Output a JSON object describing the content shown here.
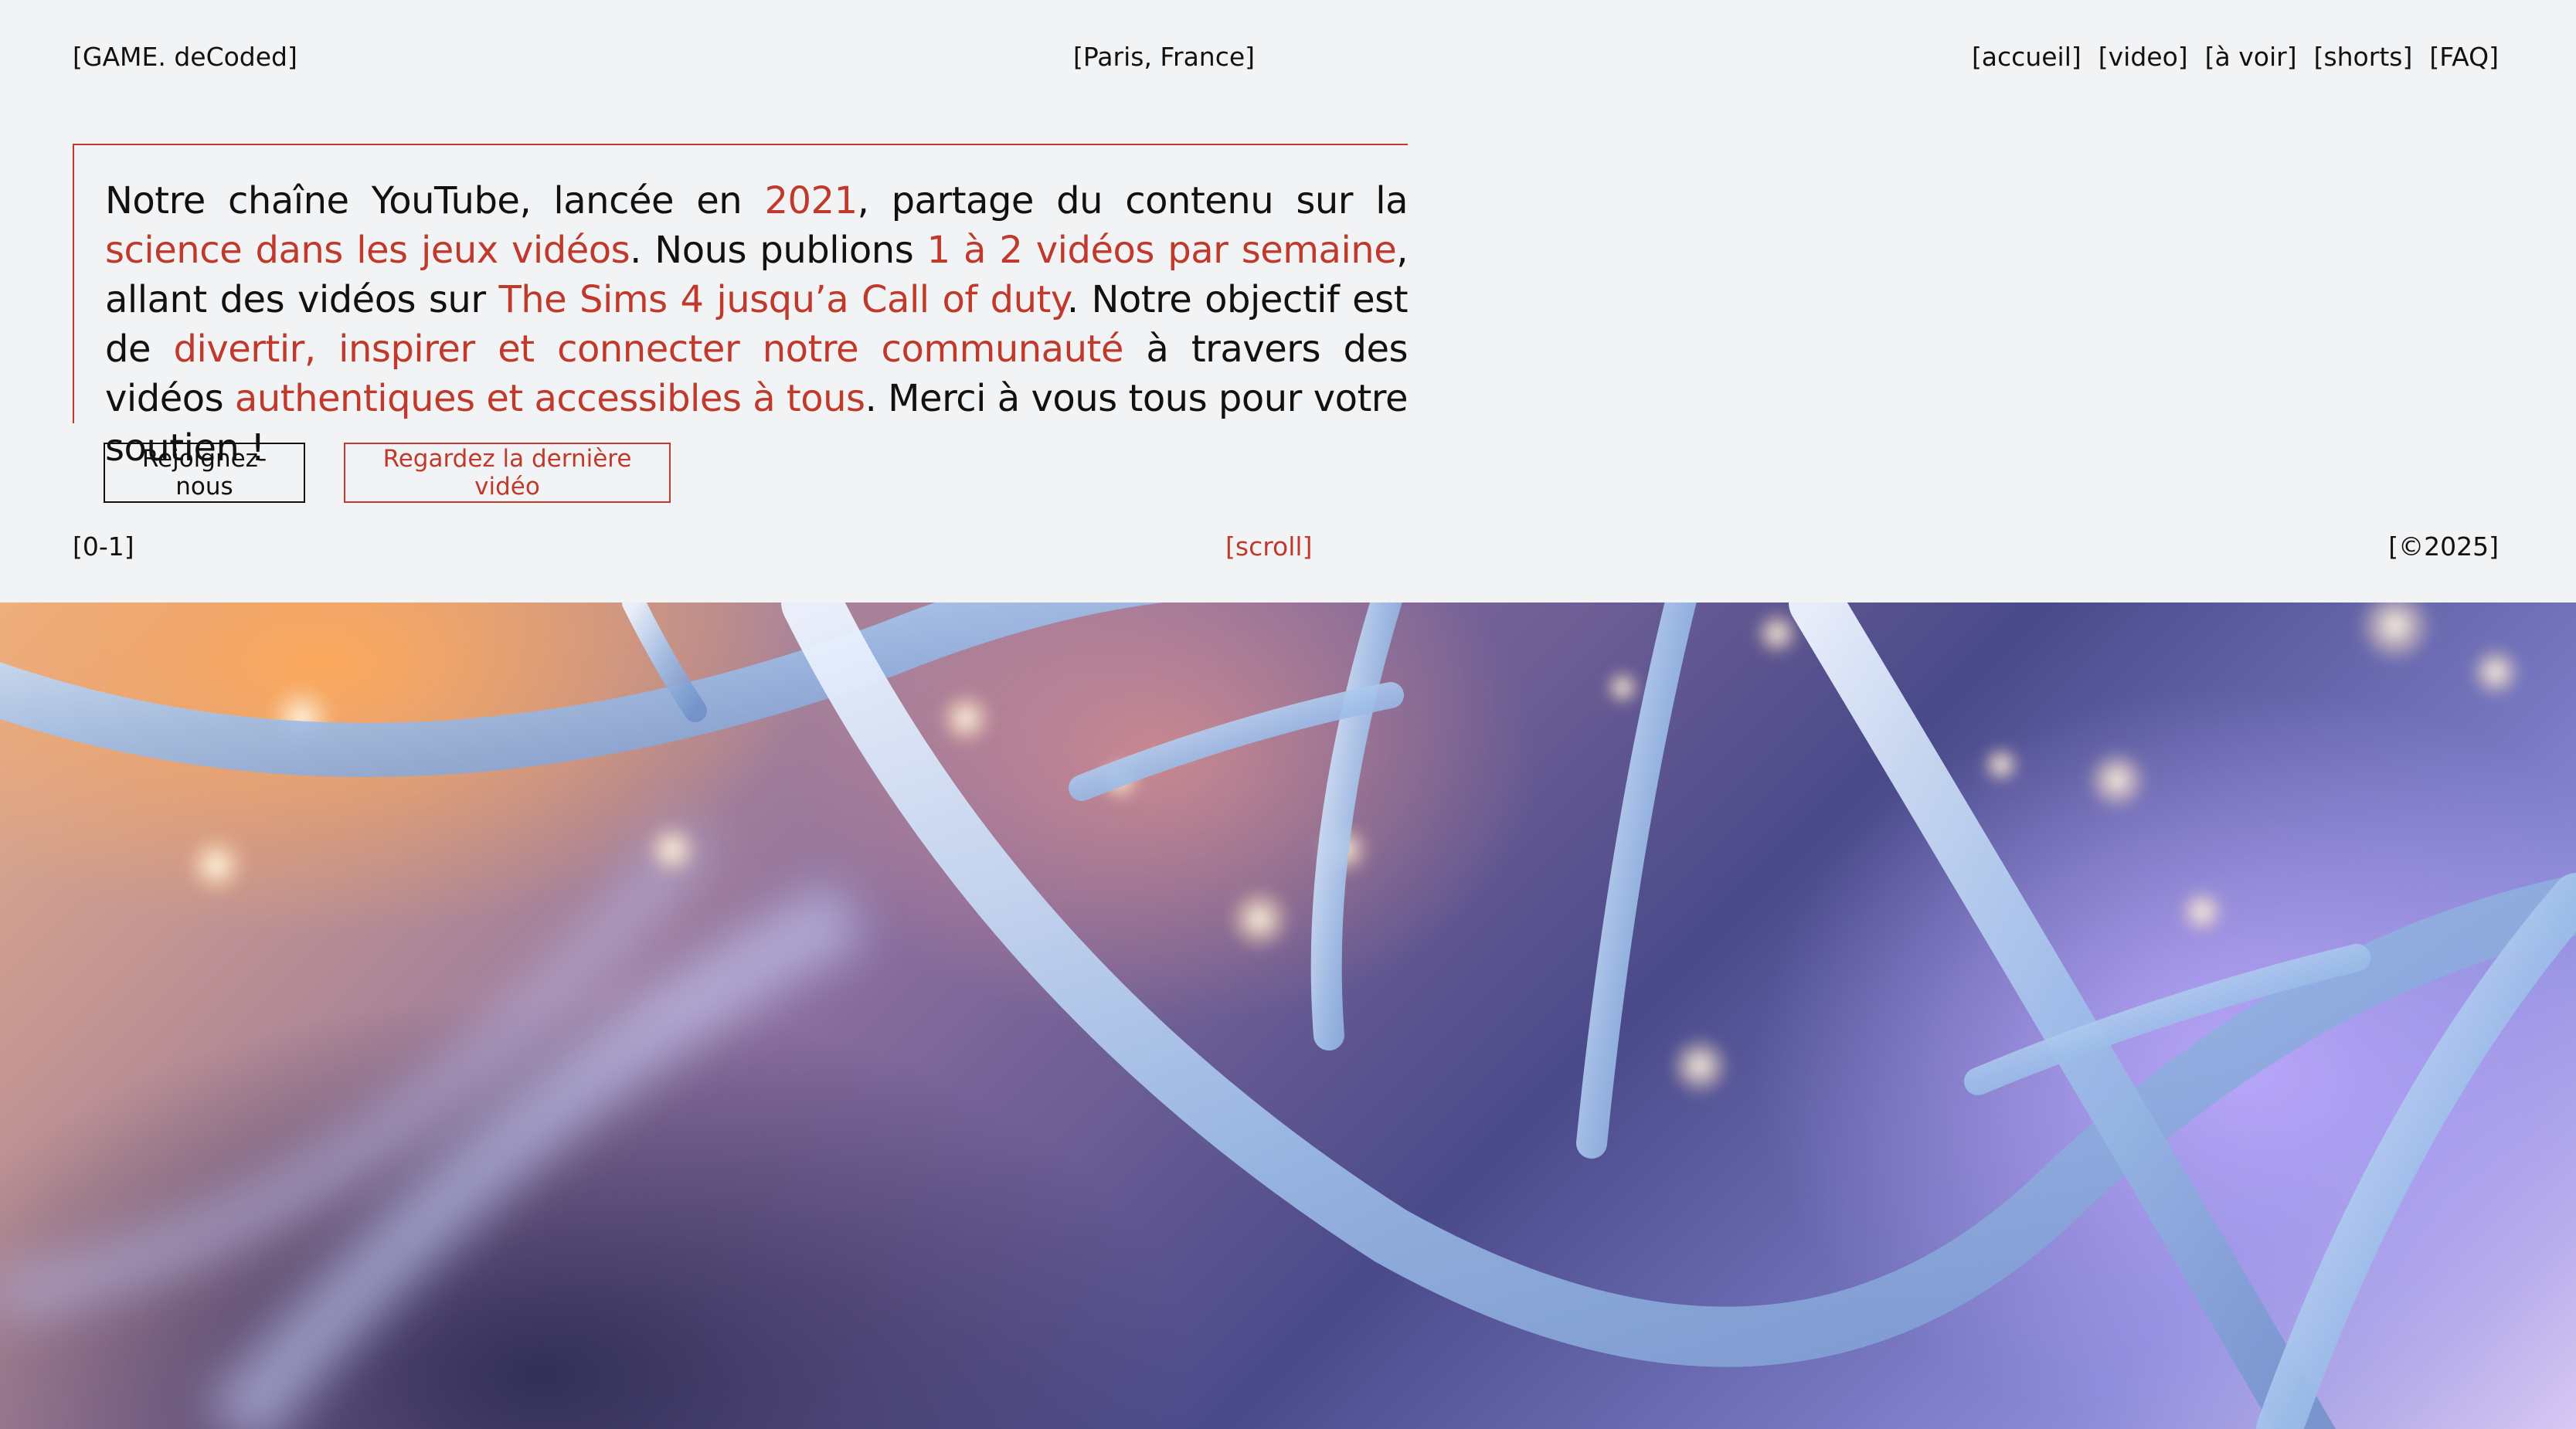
{
  "header": {
    "brand": "[GAME. deCoded]",
    "location": "[Paris, France]",
    "nav": [
      "[accueil]",
      "[video]",
      "[à voir]",
      "[shorts]",
      "[FAQ]"
    ]
  },
  "intro": {
    "segments": [
      {
        "text": "Notre chaîne YouTube, lancée en ",
        "highlight": false
      },
      {
        "text": "2021",
        "highlight": true
      },
      {
        "text": ", partage du contenu sur la ",
        "highlight": false
      },
      {
        "text": "science dans les jeux vidéos",
        "highlight": true
      },
      {
        "text": ". Nous publions ",
        "highlight": false
      },
      {
        "text": "1 à 2 vidéos par semaine",
        "highlight": true
      },
      {
        "text": ", allant des vidéos sur ",
        "highlight": false
      },
      {
        "text": "The Sims 4 jusqu’a Call of duty",
        "highlight": true
      },
      {
        "text": ". Notre objectif est de ",
        "highlight": false
      },
      {
        "text": "divertir, inspirer et connecter notre communauté",
        "highlight": true
      },
      {
        "text": " à travers des vidéos ",
        "highlight": false
      },
      {
        "text": "authentiques et accessibles à tous",
        "highlight": true
      },
      {
        "text": ". Merci à vous tous pour votre soutien !",
        "highlight": false
      }
    ]
  },
  "cta": {
    "join_label": "Rejoignez-nous",
    "watch_label": "Regardez la dernière vidéo"
  },
  "footer_meta": {
    "counter": "[0-1]",
    "scroll": "[scroll]",
    "copyright": "[©2025]"
  },
  "hero": {
    "image_name": "dna-helix-image"
  },
  "colors": {
    "accent": "#c0392b",
    "text": "#111111",
    "background": "#f2f3f5"
  }
}
